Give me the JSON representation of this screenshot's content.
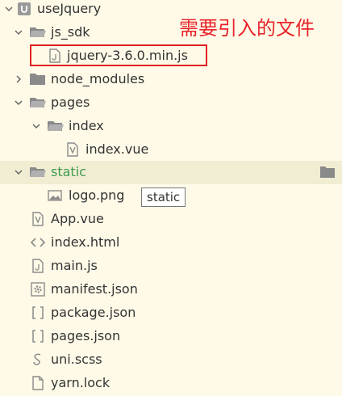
{
  "colors": {
    "background": "#fffae8",
    "selected_row": "#f1edd3",
    "selected_text": "#3d9a4e",
    "annotation": "#e8242a",
    "folder_icon": "#8a8a8a"
  },
  "tree": {
    "root_label": "useJquery",
    "js_sdk_label": "js_sdk",
    "jquery_file_label": "jquery-3.6.0.min.js",
    "node_modules_label": "node_modules",
    "pages_label": "pages",
    "index_label": "index",
    "index_vue_label": "index.vue",
    "static_label": "static",
    "logo_label": "logo.png",
    "app_vue_label": "App.vue",
    "index_html_label": "index.html",
    "main_js_label": "main.js",
    "manifest_label": "manifest.json",
    "package_label": "package.json",
    "pages_json_label": "pages.json",
    "uni_scss_label": "uni.scss",
    "yarn_lock_label": "yarn.lock"
  },
  "annotation": {
    "text": "需要引入的文件"
  },
  "tooltip": {
    "text": "static"
  }
}
